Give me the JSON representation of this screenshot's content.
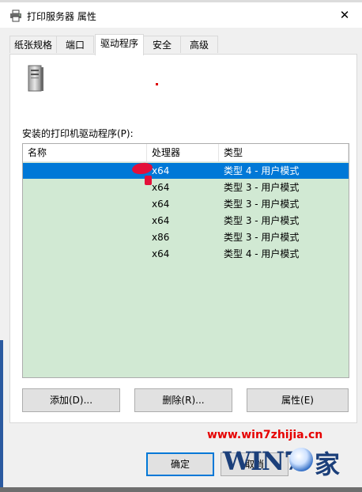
{
  "window": {
    "title": "打印服务器 属性",
    "close_glyph": "✕",
    "accent": "#0078d7"
  },
  "tabs": [
    {
      "label": "纸张规格",
      "active": false
    },
    {
      "label": "端口",
      "active": false
    },
    {
      "label": "驱动程序",
      "active": true
    },
    {
      "label": "安全",
      "active": false
    },
    {
      "label": "高级",
      "active": false
    }
  ],
  "drivers": {
    "server_icon": "server-tower-icon",
    "list_label": "安装的打印机驱动程序(P):",
    "columns": [
      "名称",
      "处理器",
      "类型"
    ],
    "rows": [
      {
        "name": "",
        "processor": "x64",
        "type": "类型 4 - 用户模式",
        "selected": true
      },
      {
        "name": "",
        "processor": "x64",
        "type": "类型 3 - 用户模式",
        "selected": false
      },
      {
        "name": "",
        "processor": "x64",
        "type": "类型 3 - 用户模式",
        "selected": false
      },
      {
        "name": "",
        "processor": "x64",
        "type": "类型 3 - 用户模式",
        "selected": false
      },
      {
        "name": "",
        "processor": "x86",
        "type": "类型 3 - 用户模式",
        "selected": false
      },
      {
        "name": "",
        "processor": "x64",
        "type": "类型 4 - 用户模式",
        "selected": false
      }
    ],
    "buttons": {
      "add": "添加(D)...",
      "remove": "删除(R)...",
      "properties": "属性(E)"
    }
  },
  "footer": {
    "ok": "确定",
    "cancel": "取消"
  },
  "watermark": {
    "url": "www.win7zhijia.cn",
    "logo_text": "WIN7",
    "logo_suffix": "家"
  }
}
